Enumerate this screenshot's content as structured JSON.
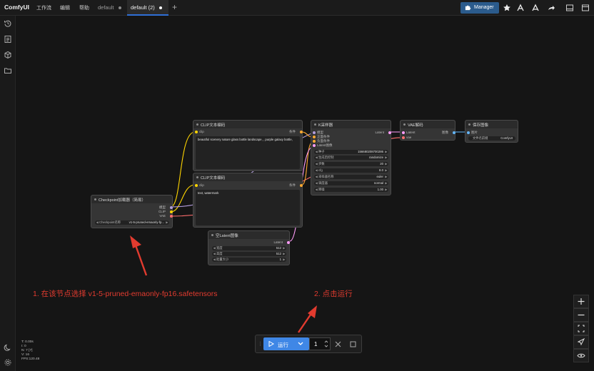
{
  "app": {
    "brand": "ComfyUI",
    "menu": [
      "工作流",
      "编辑",
      "帮助"
    ],
    "tabs": [
      {
        "label": "default",
        "active": false
      },
      {
        "label": "default (2)",
        "active": true
      }
    ],
    "manager_label": "Manager"
  },
  "nodes": {
    "checkpoint": {
      "title": "Checkpoint加载器（简易）",
      "outputs": [
        "模型",
        "CLIP",
        "VAE"
      ],
      "widget_label": "Checkpoint名称",
      "widget_value": "v1-5-pruned-emaonly-fp..."
    },
    "clip_pos": {
      "title": "CLIP文本编码",
      "input": "clip",
      "output": "条件",
      "text": "beautiful scenery nature glass bottle landscape, , purple galaxy bottle,"
    },
    "clip_neg": {
      "title": "CLIP文本编码",
      "input": "clip",
      "output": "条件",
      "text": "text, watermark"
    },
    "empty_latent": {
      "title": "空Latent图像",
      "output": "Latent",
      "widgets": [
        {
          "label": "宽度",
          "value": "512"
        },
        {
          "label": "高度",
          "value": "512"
        },
        {
          "label": "批量大小",
          "value": "1"
        }
      ]
    },
    "ksampler": {
      "title": "K采样器",
      "inputs": [
        "模型",
        "正面条件",
        "负面条件",
        "Latent图像"
      ],
      "output": "Latent",
      "widgets": [
        {
          "label": "种子",
          "value": "156680208700286"
        },
        {
          "label": "生成后控制",
          "value": "randomize"
        },
        {
          "label": "步数",
          "value": "20"
        },
        {
          "label": "cfg",
          "value": "8.0"
        },
        {
          "label": "采样器名称",
          "value": "euler"
        },
        {
          "label": "调度器",
          "value": "normal"
        },
        {
          "label": "降噪",
          "value": "1.00"
        }
      ]
    },
    "vae_decode": {
      "title": "VAE解码",
      "inputs": [
        "Latent",
        "vae"
      ],
      "output": "图像"
    },
    "save_image": {
      "title": "保存图像",
      "input": "图片",
      "widget_label": "文件名前缀",
      "widget_value": "ComfyUI"
    }
  },
  "annotations": {
    "step1": "1. 在该节点选择 v1-5-pruned-emaonly-fp16.safetensors",
    "step2": "2. 点击运行"
  },
  "runbar": {
    "run_label": "运行",
    "batch_count": "1"
  },
  "stats": [
    "T: 0.00s",
    "I: 0",
    "N: 7 [7]",
    "V: 16",
    "FPS:120.48"
  ],
  "colors": {
    "accent": "#3f87e6",
    "annotation": "#e23b2f",
    "link_clip": "#ffd500",
    "link_model": "#b39ddb",
    "link_latent": "#ff9cf9",
    "link_vae": "#ff6e6e",
    "link_cond": "#ffa931",
    "link_image": "#64b5f6"
  }
}
